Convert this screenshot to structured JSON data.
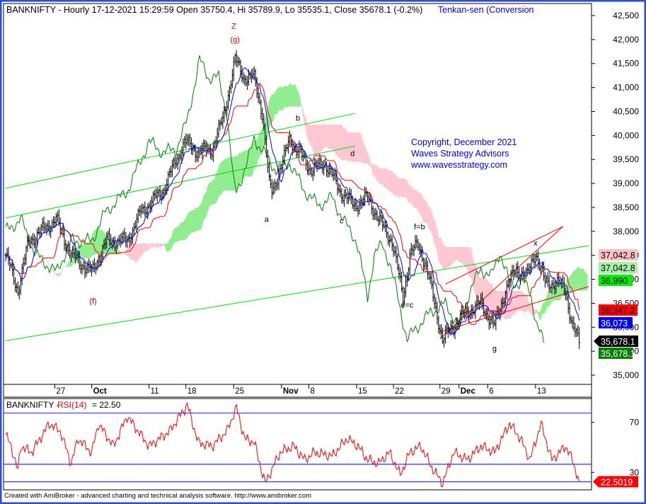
{
  "header": {
    "symbol": "BANKNIFTY - Hourly 17-12-2021 15:29:59 Open 35750.4, Hi 35789.9, Lo 35535.1, Close 35678.1 (-0.2%)",
    "indicator": "Tenkan-sen (Conversion"
  },
  "copyright": [
    "Copyright, December 2021",
    "Waves Strategy Advisors",
    "www.wavesstrategy.com"
  ],
  "footer": "Created with AmiBroker - advanced charting and technical analysis software.  http://www.amibroker.com",
  "colors": {
    "frame": "#3050c8",
    "bars": "#000000",
    "tenkan": "#0000ff",
    "kijun": "#ff0000",
    "chikou": "#008000",
    "cloud_up": "#90ee90",
    "cloud_down": "#ffc8d2",
    "channel_green": "#00dd00",
    "channel_red": "#ff0000",
    "rsi": "#ff0000",
    "rsi_levels": "#4040ff"
  },
  "chart_data": [
    {
      "type": "line",
      "title": "BANKNIFTY - Hourly",
      "ylim": [
        34700,
        42700
      ],
      "xlim": [
        0,
        428
      ],
      "y_ticks": [
        35000,
        35500,
        36000,
        36500,
        37000,
        37500,
        38000,
        38500,
        39000,
        39500,
        40000,
        40500,
        41000,
        41500,
        42000,
        42500
      ],
      "y_tick_labels": [
        "35,000",
        "35,500",
        "36,000",
        "36,500",
        "37,000",
        "37,500",
        "38,000",
        "38,500",
        "39,000",
        "39,500",
        "40,000",
        "40,500",
        "41,000",
        "41,500",
        "42,000",
        "42,500"
      ],
      "x_ticks": [
        {
          "bar": 36,
          "label": "27"
        },
        {
          "bar": 63,
          "label": "Oct",
          "bold": true
        },
        {
          "bar": 105,
          "label": "11"
        },
        {
          "bar": 132,
          "label": "18"
        },
        {
          "bar": 167,
          "label": "25"
        },
        {
          "bar": 202,
          "label": "Nov",
          "bold": true
        },
        {
          "bar": 222,
          "label": "8"
        },
        {
          "bar": 257,
          "label": "15"
        },
        {
          "bar": 284,
          "label": "22"
        },
        {
          "bar": 318,
          "label": "29"
        },
        {
          "bar": 332,
          "label": "Dec",
          "bold": true
        },
        {
          "bar": 353,
          "label": "6"
        },
        {
          "bar": 388,
          "label": "13"
        }
      ],
      "close_waypoints": [
        [
          0,
          37510
        ],
        [
          9,
          36770
        ],
        [
          17,
          37800
        ],
        [
          37,
          38250
        ],
        [
          48,
          37510
        ],
        [
          63,
          37140
        ],
        [
          74,
          37800
        ],
        [
          89,
          37800
        ],
        [
          99,
          38400
        ],
        [
          115,
          38840
        ],
        [
          131,
          39870
        ],
        [
          141,
          39650
        ],
        [
          151,
          39720
        ],
        [
          159,
          40320
        ],
        [
          168,
          41570
        ],
        [
          175,
          41200
        ],
        [
          182,
          41200
        ],
        [
          188,
          40460
        ],
        [
          193,
          38990
        ],
        [
          195,
          38840
        ],
        [
          203,
          39430
        ],
        [
          208,
          39950
        ],
        [
          213,
          39720
        ],
        [
          224,
          39280
        ],
        [
          234,
          39430
        ],
        [
          245,
          38840
        ],
        [
          255,
          38540
        ],
        [
          265,
          38700
        ],
        [
          276,
          38100
        ],
        [
          283,
          37800
        ],
        [
          291,
          36620
        ],
        [
          296,
          37510
        ],
        [
          302,
          37730
        ],
        [
          307,
          37360
        ],
        [
          312,
          36770
        ],
        [
          320,
          35740
        ],
        [
          328,
          36030
        ],
        [
          338,
          36330
        ],
        [
          348,
          36480
        ],
        [
          358,
          36030
        ],
        [
          366,
          36770
        ],
        [
          374,
          37210
        ],
        [
          382,
          37070
        ],
        [
          388,
          37580
        ],
        [
          395,
          36920
        ],
        [
          405,
          36920
        ],
        [
          410,
          36770
        ],
        [
          415,
          36030
        ],
        [
          420,
          35678.1
        ]
      ],
      "price_markers": [
        {
          "label": "37,042.8",
          "bg": "#ffc0c8",
          "fg": "#000000"
        },
        {
          "label": "37,042.8",
          "bg": "#a8f0a8",
          "fg": "#000000"
        },
        {
          "label": "36,990",
          "bg": "#00ee00",
          "fg": "#000000"
        },
        {
          "label": "36,347.2",
          "bg": "#ff0000",
          "fg": "#000000"
        },
        {
          "label": "36,073",
          "bg": "#0000ff",
          "fg": "#ffffff"
        },
        {
          "label": "35,678.1",
          "bg": "#000000",
          "fg": "#ffffff"
        },
        {
          "label": "35,678.1",
          "bg": "#008000",
          "fg": "#ffffff"
        }
      ],
      "trendlines": [
        {
          "color": "#00dd00",
          "from": [
            0,
            38900
          ],
          "to": [
            256,
            40460
          ]
        },
        {
          "color": "#00dd00",
          "from": [
            0,
            38280
          ],
          "to": [
            256,
            39780
          ]
        },
        {
          "color": "#00dd00",
          "from": [
            0,
            35720
          ],
          "to": [
            427,
            37700
          ]
        },
        {
          "color": "#ff0000",
          "from": [
            318,
            35760
          ],
          "to": [
            408,
            38100
          ]
        },
        {
          "color": "#ff0000",
          "from": [
            318,
            35900
          ],
          "to": [
            427,
            36850
          ]
        },
        {
          "color": "#ff0000",
          "from": [
            322,
            36900
          ],
          "to": [
            408,
            38100
          ]
        }
      ],
      "wave_labels": [
        {
          "text": "Z",
          "bar": 167,
          "price": 42230
        },
        {
          "text": "(g)",
          "bar": 168,
          "price": 41950
        },
        {
          "text": "(f)",
          "bar": 64,
          "price": 36490
        },
        {
          "text": "a",
          "bar": 191,
          "price": 38200
        },
        {
          "text": "b",
          "bar": 214,
          "price": 40310
        },
        {
          "text": "d",
          "bar": 254,
          "price": 39570
        },
        {
          "text": "c",
          "bar": 246,
          "price": 38170
        },
        {
          "text": "f=b",
          "bar": 303,
          "price": 38040
        },
        {
          "text": "e=c",
          "bar": 294,
          "price": 36410
        },
        {
          "text": "g",
          "bar": 358,
          "price": 35500
        },
        {
          "text": "x",
          "bar": 388,
          "price": 37700
        }
      ]
    },
    {
      "type": "line",
      "title": "BANKNIFTY - ",
      "indicator": "RSI(14)",
      "value_text": "= 22.50",
      "last_value": "22.5019",
      "ylim": [
        18,
        88
      ],
      "y_ticks": [
        30,
        70
      ],
      "y_tick_labels": [
        "30",
        "70"
      ],
      "levels": [
        77.5,
        36.5,
        22.5
      ],
      "values": [
        [
          0,
          60
        ],
        [
          4,
          51
        ],
        [
          9,
          31
        ],
        [
          11,
          51
        ],
        [
          19,
          46
        ],
        [
          32,
          69
        ],
        [
          40,
          63
        ],
        [
          48,
          37
        ],
        [
          53,
          57
        ],
        [
          63,
          46
        ],
        [
          68,
          69
        ],
        [
          79,
          51
        ],
        [
          89,
          75
        ],
        [
          105,
          51
        ],
        [
          120,
          63
        ],
        [
          133,
          84
        ],
        [
          141,
          54
        ],
        [
          151,
          51
        ],
        [
          162,
          63
        ],
        [
          169,
          82
        ],
        [
          175,
          57
        ],
        [
          182,
          54
        ],
        [
          190,
          21
        ],
        [
          201,
          46
        ],
        [
          211,
          51
        ],
        [
          219,
          40
        ],
        [
          226,
          46
        ],
        [
          239,
          43
        ],
        [
          250,
          57
        ],
        [
          258,
          51
        ],
        [
          265,
          40
        ],
        [
          273,
          37
        ],
        [
          281,
          46
        ],
        [
          289,
          28
        ],
        [
          296,
          46
        ],
        [
          304,
          51
        ],
        [
          312,
          34
        ],
        [
          320,
          21
        ],
        [
          328,
          46
        ],
        [
          338,
          40
        ],
        [
          348,
          51
        ],
        [
          358,
          46
        ],
        [
          369,
          69
        ],
        [
          377,
          57
        ],
        [
          384,
          40
        ],
        [
          392,
          69
        ],
        [
          400,
          40
        ],
        [
          410,
          51
        ],
        [
          415,
          40
        ],
        [
          420,
          22.5
        ]
      ]
    }
  ]
}
